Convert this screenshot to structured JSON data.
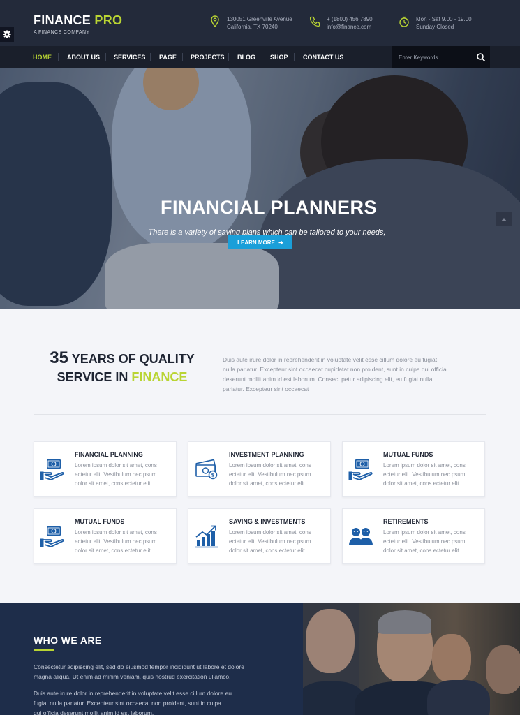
{
  "header": {
    "logo_text": "FINANCE",
    "logo_accent": "PRO",
    "tagline": "A FINANCE COMPANY",
    "address_line1": "130051 Greenville Avenue",
    "address_line2": "California, TX 70240",
    "phone": "+ (1800) 456 7890",
    "email": "info@finance.com",
    "hours_line1": "Mon - Sat 9.00 - 19.00",
    "hours_line2": "Sunday Closed"
  },
  "nav": {
    "items": [
      {
        "label": "HOME",
        "active": true
      },
      {
        "label": "ABOUT US"
      },
      {
        "label": "SERVICES"
      },
      {
        "label": "PAGE"
      },
      {
        "label": "PROJECTS"
      },
      {
        "label": "BLOG"
      },
      {
        "label": "SHOP"
      },
      {
        "label": "CONTACT US"
      }
    ]
  },
  "search": {
    "placeholder": "Enter Keywords",
    "value": ""
  },
  "hero": {
    "title": "FINANCIAL PLANNERS",
    "subtitle": "There is a variety of saving plans which can be tailored to your needs,",
    "button_label": "LEARN MORE"
  },
  "intro": {
    "years": "35",
    "heading_part1": "YEARS OF QUALITY",
    "heading_part2": "SERVICE IN",
    "heading_accent": "FINANCE",
    "text_lines": [
      "Duis aute irure dolor in reprehenderit in voluptate velit esse cillum dolore eu fugiat",
      "nulla pariatur. Excepteur sint occaecat cupidatat non proident, sunt in culpa qui officia",
      "deserunt mollit anim id est laborum. Consect petur adipiscing elit, eu fugiat nulla",
      "pariatur. Excepteur sint occaecat"
    ]
  },
  "services": [
    {
      "title": "FINANCIAL PLANNING",
      "icon": "money-hand-icon",
      "lines": [
        "Lorem ipsum dolor sit amet, cons",
        "ectetur elit. Vestibulum nec psum",
        "dolor sit amet, cons ectetur elit."
      ]
    },
    {
      "title": "INVESTMENT PLANNING",
      "icon": "money-bills-icon",
      "lines": [
        "Lorem ipsum dolor sit amet, cons",
        "ectetur elit. Vestibulum nec psum",
        "dolor sit amet, cons ectetur elit."
      ]
    },
    {
      "title": "MUTUAL FUNDS",
      "icon": "money-hand-icon",
      "lines": [
        "Lorem ipsum dolor sit amet, cons",
        "ectetur elit. Vestibulum nec psum",
        "dolor sit amet, cons ectetur elit."
      ]
    },
    {
      "title": "MUTUAL FUNDS",
      "icon": "money-hand-icon",
      "lines": [
        "Lorem ipsum dolor sit amet, cons",
        "ectetur elit. Vestibulum nec psum",
        "dolor sit amet, cons ectetur elit."
      ]
    },
    {
      "title": "SAVING & INVESTMENTS",
      "icon": "growth-chart-icon",
      "lines": [
        "Lorem ipsum dolor sit amet, cons",
        "ectetur elit. Vestibulum nec psum",
        "dolor sit amet, cons ectetur elit."
      ]
    },
    {
      "title": "RETIREMENTS",
      "icon": "people-icon",
      "lines": [
        "Lorem ipsum dolor sit amet, cons",
        "ectetur elit. Vestibulum nec psum",
        "dolor sit amet, cons ectetur elit."
      ]
    }
  ],
  "who": {
    "title": "WHO WE ARE",
    "p1_lines": [
      "Consectetur adipiscing elit, sed do eiusmod tempor incididunt ut labore et dolore",
      "magna aliqua. Ut enim ad minim veniam, quis nostrud exercitation ullamco."
    ],
    "p2_lines": [
      "Duis aute irure dolor in reprehenderit in voluptate velit esse cillum dolore eu",
      "fugiat nulla pariatur. Excepteur sint occaecat non proident, sunt in culpa",
      "qui officia deserunt mollit anim id est laborum."
    ]
  },
  "colors": {
    "accent": "#b9d433",
    "primary_blue": "#1a9fd9",
    "icon_blue": "#1e5fa8",
    "dark_navy": "#232a3a"
  }
}
